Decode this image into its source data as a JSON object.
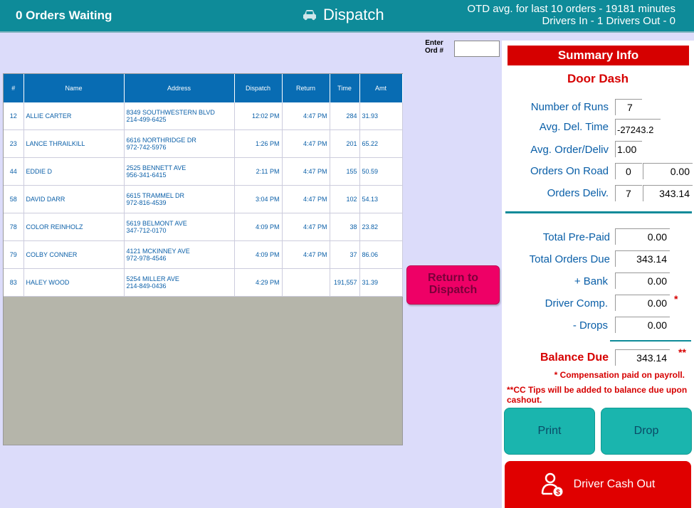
{
  "header": {
    "orders_waiting": "0 Orders Waiting",
    "title": "Dispatch",
    "otd_line": "OTD avg. for last 10 orders - 19181 minutes",
    "drivers_line": "Drivers In - 1   Drivers Out - 0"
  },
  "order_entry": {
    "label_line1": "Enter",
    "label_line2": "Ord #",
    "value": ""
  },
  "table": {
    "columns": [
      "#",
      "Name",
      "Address",
      "Dispatch",
      "Return",
      "Time",
      "Amt"
    ],
    "rows": [
      {
        "num": "12",
        "name": "ALLIE CARTER",
        "address": "8349 SOUTHWESTERN BLVD",
        "phone": "214-499-6425",
        "dispatch": "12:02 PM",
        "return": "4:47 PM",
        "time": "284",
        "amt": "31.93"
      },
      {
        "num": "23",
        "name": "LANCE THRAILKILL",
        "address": "6616 NORTHRIDGE DR",
        "phone": "972-742-5976",
        "dispatch": "1:26 PM",
        "return": "4:47 PM",
        "time": "201",
        "amt": "65.22"
      },
      {
        "num": "44",
        "name": "EDDIE D",
        "address": "2525 BENNETT AVE",
        "phone": "956-341-6415",
        "dispatch": "2:11 PM",
        "return": "4:47 PM",
        "time": "155",
        "amt": "50.59"
      },
      {
        "num": "58",
        "name": "DAVID DARR",
        "address": "6615 TRAMMEL DR",
        "phone": "972-816-4539",
        "dispatch": "3:04 PM",
        "return": "4:47 PM",
        "time": "102",
        "amt": "54.13"
      },
      {
        "num": "78",
        "name": "COLOR REINHOLZ",
        "address": "5619 BELMONT AVE",
        "phone": "347-712-0170",
        "dispatch": "4:09 PM",
        "return": "4:47 PM",
        "time": "38",
        "amt": "23.82"
      },
      {
        "num": "79",
        "name": "COLBY CONNER",
        "address": "4121 MCKINNEY AVE",
        "phone": "972-978-4546",
        "dispatch": "4:09 PM",
        "return": "4:47 PM",
        "time": "37",
        "amt": "86.06"
      },
      {
        "num": "83",
        "name": "HALEY WOOD",
        "address": "5254 MILLER AVE",
        "phone": "214-849-0436",
        "dispatch": "4:29 PM",
        "return": "",
        "time": "191,557",
        "amt": "31.39"
      }
    ]
  },
  "return_button": {
    "label": "Return to Dispatch"
  },
  "summary": {
    "title": "Summary Info",
    "driver": "Door Dash",
    "runs_label": "Number of Runs",
    "runs_value": "7",
    "avg_del_label": "Avg. Del. Time",
    "avg_del_value": "-27243.2",
    "avg_order_label": "Avg. Order/Deliv",
    "avg_order_value": "1.00",
    "on_road_label": "Orders On Road",
    "on_road_count": "0",
    "on_road_amount": "0.00",
    "delivered_label": "Orders Deliv.",
    "delivered_count": "7",
    "delivered_amount": "343.14",
    "prepaid_label": "Total Pre-Paid",
    "prepaid_value": "0.00",
    "orders_due_label": "Total Orders Due",
    "orders_due_value": "343.14",
    "bank_label": "+ Bank",
    "bank_value": "0.00",
    "driver_comp_label": "Driver Comp.",
    "driver_comp_value": "0.00",
    "driver_comp_mark": "*",
    "drops_label": "- Drops",
    "drops_value": "0.00",
    "balance_label": "Balance Due",
    "balance_value": "343.14",
    "balance_mark": "**",
    "note1": "* Compensation paid on payroll.",
    "note2": "**CC Tips will be added to balance due upon cashout."
  },
  "buttons": {
    "print": "Print",
    "drop": "Drop",
    "cashout": "Driver Cash Out"
  },
  "icons": {
    "title_icon": "car-icon",
    "cashout_icon": "driver-cash-icon"
  },
  "colors": {
    "header": "#0e8b99",
    "table_header": "#086cb3",
    "accent_red": "#d60000",
    "return_button": "#ee0066",
    "action_teal": "#1ab5ae"
  }
}
